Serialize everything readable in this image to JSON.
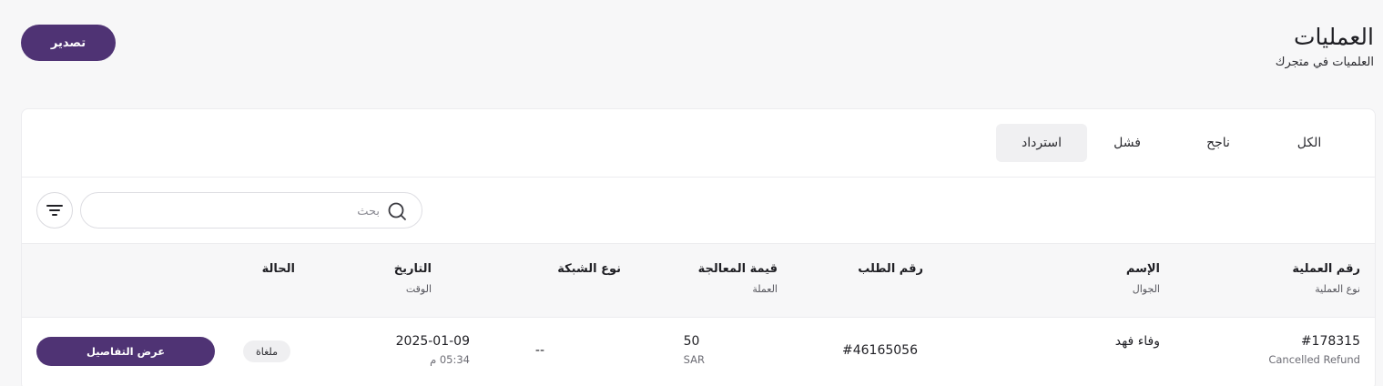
{
  "header": {
    "title": "العمليات",
    "subtitle": "العلميات في متجرك",
    "export_label": "تصدير"
  },
  "tabs": [
    {
      "label": "الكل",
      "active": false
    },
    {
      "label": "ناجح",
      "active": false
    },
    {
      "label": "فشل",
      "active": false
    },
    {
      "label": "استرداد",
      "active": true
    }
  ],
  "search": {
    "placeholder": "بحث",
    "value": ""
  },
  "table": {
    "columns": [
      {
        "label": "رقم العملية",
        "sublabel": "نوع العملية"
      },
      {
        "label": "الإسم",
        "sublabel": "الجوال"
      },
      {
        "label": "رقم الطلب",
        "sublabel": ""
      },
      {
        "label": "قيمة المعالجة",
        "sublabel": "العملة"
      },
      {
        "label": "نوع الشبكة",
        "sublabel": ""
      },
      {
        "label": "التاريخ",
        "sublabel": "الوقت"
      },
      {
        "label": "الحالة",
        "sublabel": ""
      }
    ],
    "rows": [
      {
        "operation_number": "#178315",
        "operation_type": "Cancelled Refund",
        "name": "وفاء فهد",
        "phone": "",
        "order_number": "#46165056",
        "amount": "50",
        "currency": "SAR",
        "network_type": "--",
        "date": "2025-01-09",
        "time": "05:34 م",
        "status": "ملغاة",
        "details_label": "عرض التفاصيل"
      }
    ]
  },
  "colors": {
    "primary": "#4f3374",
    "background": "#f7f7f8",
    "card": "#ffffff",
    "border": "#ececef"
  }
}
